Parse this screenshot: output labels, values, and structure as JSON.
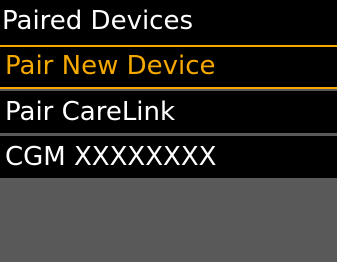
{
  "header": {
    "title": "Paired Devices"
  },
  "menu": {
    "items": [
      {
        "label": "Pair New Device",
        "selected": true
      },
      {
        "label": "Pair CareLink",
        "selected": false
      },
      {
        "label": "CGM XXXXXXXX",
        "selected": false
      }
    ]
  },
  "colors": {
    "header_bg": "#000000",
    "item_bg": "#000000",
    "body_bg": "#595959",
    "text": "#ffffff",
    "highlight": "#f5a800"
  }
}
